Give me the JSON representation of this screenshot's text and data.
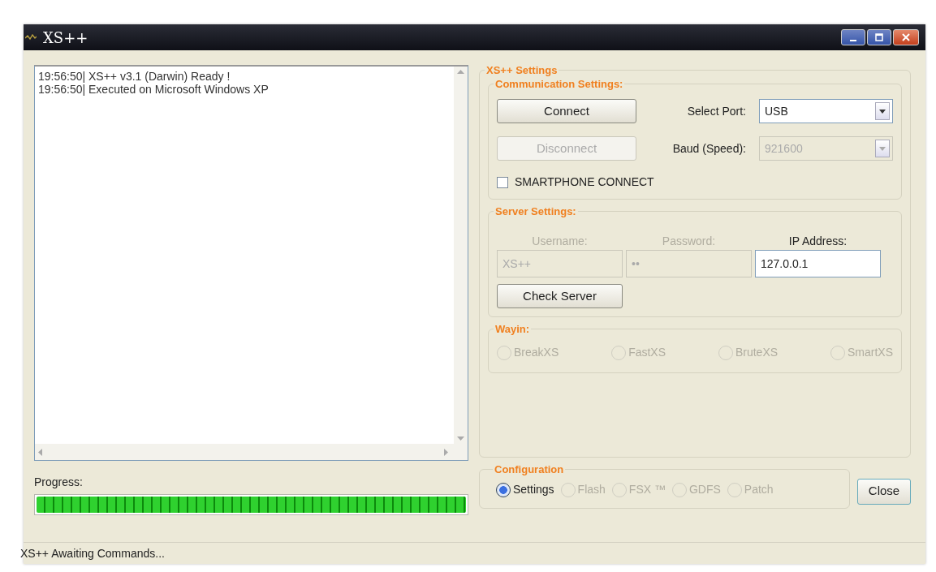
{
  "window": {
    "title": "XS++"
  },
  "log": {
    "lines": [
      "19:56:50| XS++ v3.1 (Darwin) Ready !",
      "19:56:50| Executed on Microsoft Windows XP"
    ]
  },
  "progress": {
    "label": "Progress:",
    "level": 1
  },
  "settings": {
    "title": "XS++ Settings",
    "communication": {
      "title": "Communication Settings:",
      "connect": {
        "label": "Connect",
        "disabled": false
      },
      "disconnect": {
        "label": "Disconnect",
        "disabled": true
      },
      "port": {
        "label": "Select Port:",
        "value": "USB",
        "disabled": false
      },
      "baud": {
        "label": "Baud (Speed):",
        "value": "921600",
        "disabled": true
      },
      "smartphone": {
        "label": "SMARTPHONE CONNECT",
        "checked": false
      }
    },
    "server": {
      "title": "Server Settings:",
      "fields": [
        {
          "label": "Username:",
          "value": "XS++",
          "disabled": true
        },
        {
          "label": "Password:",
          "value": "••",
          "disabled": true
        },
        {
          "label": "IP Address:",
          "value": "127.0.0.1",
          "disabled": false
        }
      ],
      "check": {
        "label": "Check Server",
        "disabled": false
      }
    },
    "wayin": {
      "title": "Wayin:",
      "options": [
        {
          "label": "BreakXS",
          "selected": false,
          "disabled": true
        },
        {
          "label": "FastXS",
          "selected": false,
          "disabled": true
        },
        {
          "label": "BruteXS",
          "selected": false,
          "disabled": true
        },
        {
          "label": "SmartXS",
          "selected": false,
          "disabled": true
        }
      ]
    }
  },
  "configuration": {
    "title": "Configuration",
    "options": [
      {
        "label": "Settings",
        "selected": true,
        "disabled": false
      },
      {
        "label": "Flash",
        "selected": false,
        "disabled": true
      },
      {
        "label": "FSX ™",
        "selected": false,
        "disabled": true
      },
      {
        "label": "GDFS",
        "selected": false,
        "disabled": true
      },
      {
        "label": "Patch",
        "selected": false,
        "disabled": true
      }
    ]
  },
  "close_button": {
    "label": "Close"
  },
  "status_bar": {
    "text": "XS++ Awaiting Commands..."
  }
}
